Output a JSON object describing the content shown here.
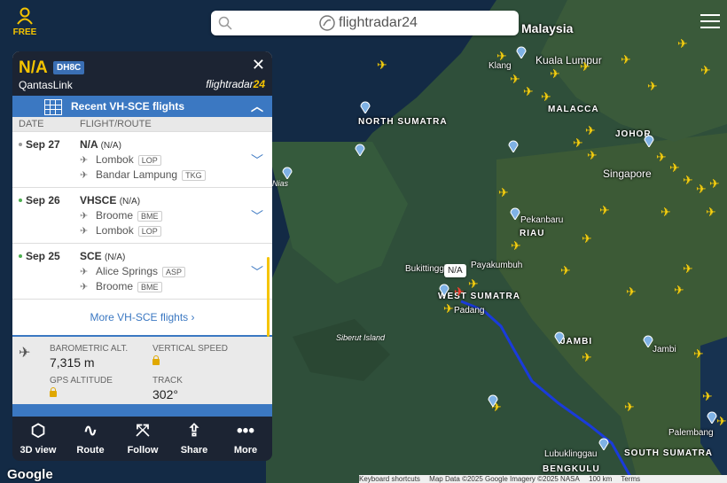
{
  "topbar": {
    "free_label": "FREE",
    "brand": "flightradar24",
    "colors": {
      "accent": "#f5c400"
    }
  },
  "panel": {
    "callsign": "N/A",
    "aircraft_code": "DH8C",
    "airline": "QantasLink",
    "brand_left": "flightradar",
    "brand_right": "24",
    "recent_label": "Recent VH-SCE flights",
    "col_date": "DATE",
    "col_route": "FLIGHT/ROUTE",
    "flights": [
      {
        "date": "Sep 27",
        "flight": "N/A",
        "sub": "(N/A)",
        "from": "Lombok",
        "from_code": "LOP",
        "to": "Bandar Lampung",
        "to_code": "TKG",
        "status_color": "#999999"
      },
      {
        "date": "Sep 26",
        "flight": "VHSCE",
        "sub": "(N/A)",
        "from": "Broome",
        "from_code": "BME",
        "to": "Lombok",
        "to_code": "LOP",
        "status_color": "#4caf50"
      },
      {
        "date": "Sep 25",
        "flight": "SCE",
        "sub": "(N/A)",
        "from": "Alice Springs",
        "from_code": "ASP",
        "to": "Broome",
        "to_code": "BME",
        "status_color": "#4caf50"
      }
    ],
    "more_label": "More VH-SCE flights ›",
    "stats": {
      "baro_label": "BAROMETRIC ALT.",
      "baro_value": "7,315 m",
      "vs_label": "VERTICAL SPEED",
      "gps_label": "GPS ALTITUDE",
      "track_label": "TRACK",
      "track_value": "302°"
    }
  },
  "toolbar": [
    {
      "label": "3D view",
      "icon": "cube-icon"
    },
    {
      "label": "Route",
      "icon": "route-icon"
    },
    {
      "label": "Follow",
      "icon": "follow-icon"
    },
    {
      "label": "Share",
      "icon": "share-icon"
    },
    {
      "label": "More",
      "icon": "more-icon"
    }
  ],
  "map": {
    "regions": [
      "Malaysia",
      "NORTH SUMATRA",
      "MALACCA",
      "JOHOR",
      "RIAU",
      "WEST SUMATRA",
      "JAMBI",
      "SOUTH SUMATRA",
      "BENGKULU"
    ],
    "cities": [
      "Kuala Lumpur",
      "Klang",
      "Singapore",
      "Pekanbaru",
      "Bukittinggi",
      "Payakumbuh",
      "Padang",
      "Jambi",
      "Palembang",
      "Lubuklinggau"
    ],
    "islands": [
      "Siberut Island",
      "Nias"
    ],
    "tooltip": "N/A",
    "google": "Google",
    "footer": [
      "Keyboard shortcuts",
      "Map Data ©2025 Google Imagery ©2025 NASA",
      "100 km",
      "Terms"
    ]
  }
}
